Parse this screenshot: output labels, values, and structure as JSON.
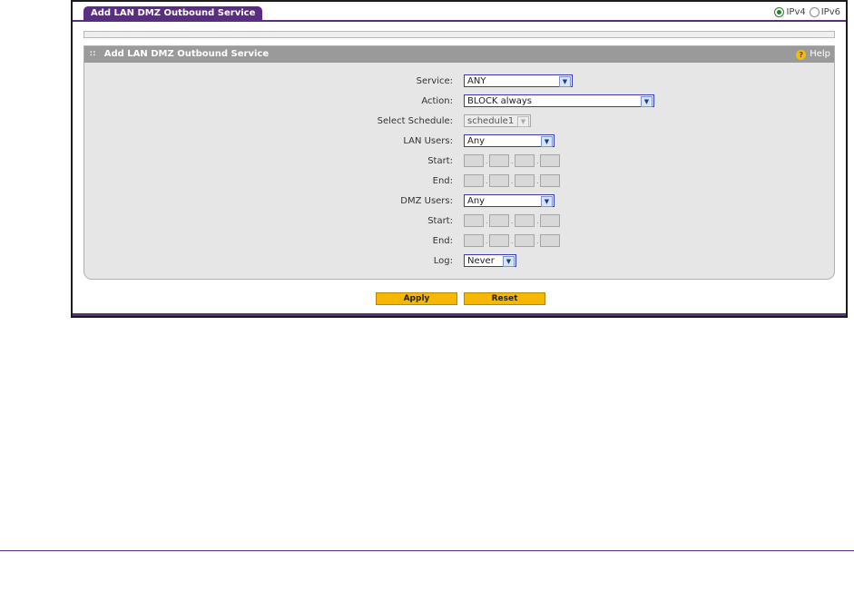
{
  "tab": {
    "title": "Add LAN DMZ Outbound Service"
  },
  "ip_version": {
    "options": [
      "IPv4",
      "IPv6"
    ],
    "selected": "IPv4"
  },
  "panel": {
    "title": "Add LAN DMZ Outbound Service",
    "help_label": "Help"
  },
  "form": {
    "service": {
      "label": "Service:",
      "value": "ANY"
    },
    "action": {
      "label": "Action:",
      "value": "BLOCK always"
    },
    "schedule": {
      "label": "Select Schedule:",
      "value": "schedule1"
    },
    "lan_users": {
      "label": "LAN Users:",
      "value": "Any"
    },
    "lan_start": {
      "label": "Start:"
    },
    "lan_end": {
      "label": "End:"
    },
    "dmz_users": {
      "label": "DMZ Users:",
      "value": "Any"
    },
    "dmz_start": {
      "label": "Start:"
    },
    "dmz_end": {
      "label": "End:"
    },
    "log": {
      "label": "Log:",
      "value": "Never"
    }
  },
  "buttons": {
    "apply": "Apply",
    "reset": "Reset"
  }
}
